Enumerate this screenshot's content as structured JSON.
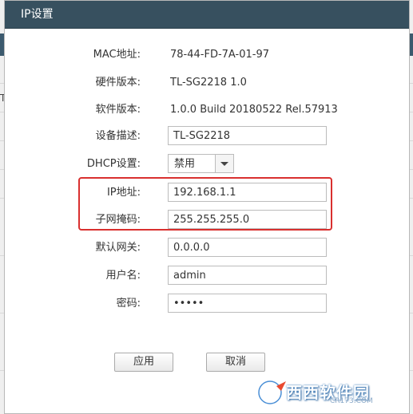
{
  "dialog": {
    "title": "IP设置"
  },
  "background": {
    "edge_glyph": "T"
  },
  "fields": {
    "mac": {
      "label": "MAC地址:",
      "value": "78-44-FD-7A-01-97"
    },
    "hardware": {
      "label": "硬件版本:",
      "value": "TL-SG2218 1.0"
    },
    "software": {
      "label": "软件版本:",
      "value": "1.0.0 Build 20180522 Rel.57913"
    },
    "description": {
      "label": "设备描述:",
      "value": "TL-SG2218"
    },
    "dhcp": {
      "label": "DHCP设置:",
      "value": "禁用"
    },
    "ip": {
      "label": "IP地址:",
      "value": "192.168.1.1"
    },
    "subnet": {
      "label": "子网掩码:",
      "value": "255.255.255.0"
    },
    "gateway": {
      "label": "默认网关:",
      "value": "0.0.0.0"
    },
    "username": {
      "label": "用户名:",
      "value": "admin"
    },
    "password": {
      "label": "密码:",
      "value": "•••••"
    }
  },
  "buttons": {
    "apply": "应用",
    "cancel": "取消"
  },
  "watermark": {
    "text": "西西软件园",
    "sub": "CR173.COM"
  },
  "colors": {
    "titlebar": "#37505f",
    "highlight": "#d9302f"
  },
  "icons": {
    "dropdown": "chevron-down-icon",
    "watermark_logo": "logo-icon"
  }
}
